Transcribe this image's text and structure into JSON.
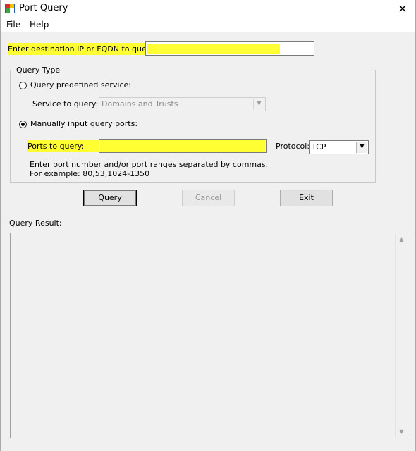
{
  "window": {
    "title": "Port Query",
    "close_glyph": "✕",
    "icon": "app-icon"
  },
  "menu": {
    "file": "File",
    "help": "Help"
  },
  "destination": {
    "label": "Enter destination IP or FQDN to query:",
    "value": ""
  },
  "query_type": {
    "group_label": "Query Type",
    "predefined_label": "Query predefined service:",
    "predefined_selected": false,
    "service_label": "Service to query:",
    "service_value": "Domains and Trusts",
    "manual_label": "Manually input query ports:",
    "manual_selected": true,
    "ports_label": "Ports to query:",
    "ports_value": "",
    "protocol_label": "Protocol:",
    "protocol_value": "TCP",
    "hint_line1": "Enter port number and/or port ranges separated by commas.",
    "hint_line2": "For example: 80,53,1024-1350"
  },
  "buttons": {
    "query": "Query",
    "cancel": "Cancel",
    "exit": "Exit"
  },
  "result": {
    "label": "Query Result:",
    "text": ""
  },
  "colors": {
    "highlight": "#ffff33",
    "window_bg": "#f0f0f0"
  }
}
